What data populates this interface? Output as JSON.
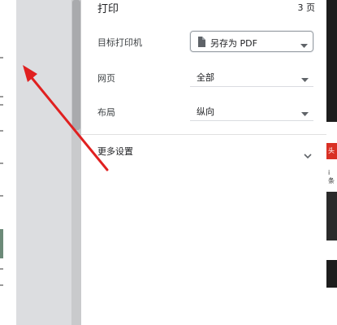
{
  "dialog": {
    "title": "打印",
    "page_count": "3 页",
    "fields": {
      "destination": {
        "label": "目标打印机",
        "value": "另存为 PDF"
      },
      "pages": {
        "label": "网页",
        "value": "全部"
      },
      "layout": {
        "label": "布局",
        "value": "纵向"
      }
    },
    "more_settings": "更多设置"
  },
  "right_web": {
    "snippet_1": "头",
    "snippet_2": "i 条"
  },
  "colors": {
    "annotation_arrow": "#e02020",
    "gutter": "#dcdde0",
    "highlight_border": "#9aa0a6"
  },
  "icons": {
    "document": "document-icon",
    "caret": "caret-down-icon",
    "chevron": "chevron-down-icon"
  }
}
